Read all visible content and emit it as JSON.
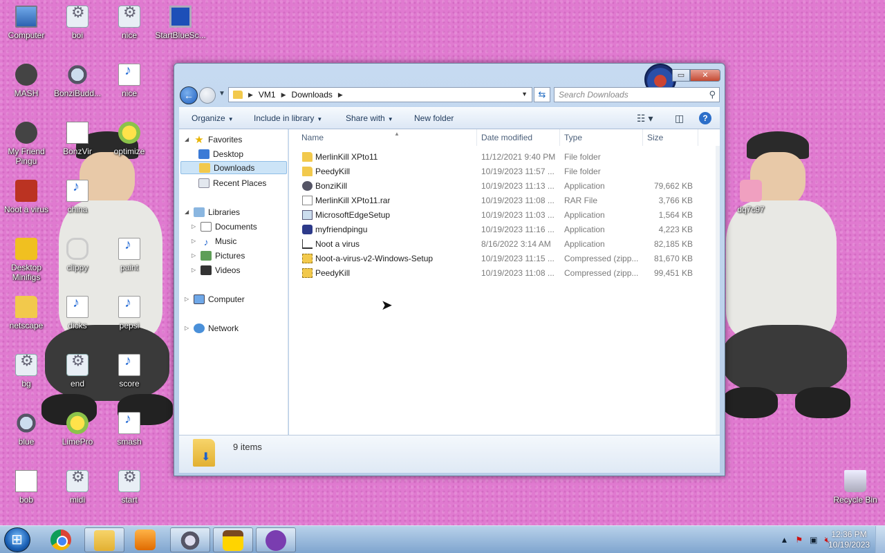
{
  "desktop": {
    "icons": [
      {
        "label": "Computer",
        "icon": "computer-icon"
      },
      {
        "label": "boi",
        "icon": "gear-icon"
      },
      {
        "label": "nice",
        "icon": "gear-icon"
      },
      {
        "label": "StartBlueSc...",
        "icon": "monitor-icon"
      },
      {
        "label": "MASH",
        "icon": "character-icon"
      },
      {
        "label": "BonziBudd...",
        "icon": "ufo-icon"
      },
      {
        "label": "nice",
        "icon": "audio-icon"
      },
      {
        "label": "My Friend Pingu",
        "icon": "pingu-icon"
      },
      {
        "label": "BonzVir",
        "icon": "document-icon"
      },
      {
        "label": "optimize",
        "icon": "optimize-icon"
      },
      {
        "label": "Noot a virus",
        "icon": "noot-icon"
      },
      {
        "label": "china",
        "icon": "audio-icon"
      },
      {
        "label": "Desktop Minifigs",
        "icon": "minifig-icon"
      },
      {
        "label": "clippy",
        "icon": "paperclip-icon"
      },
      {
        "label": "paint",
        "icon": "audio-icon"
      },
      {
        "label": "netscape",
        "icon": "folder-icon"
      },
      {
        "label": "dicks",
        "icon": "audio-icon"
      },
      {
        "label": "pepsi",
        "icon": "audio-icon"
      },
      {
        "label": "bg",
        "icon": "gear-icon"
      },
      {
        "label": "end",
        "icon": "gear-icon"
      },
      {
        "label": "score",
        "icon": "audio-icon"
      },
      {
        "label": "blue",
        "icon": "ufo-icon"
      },
      {
        "label": "LimePro",
        "icon": "lime-icon"
      },
      {
        "label": "smash",
        "icon": "audio-icon"
      },
      {
        "label": "bob",
        "icon": "document-icon"
      },
      {
        "label": "midi",
        "icon": "gear-icon"
      },
      {
        "label": "start",
        "icon": "gear-icon"
      },
      {
        "label": "dq7c97",
        "icon": "video-icon"
      },
      {
        "label": "Recycle Bin",
        "icon": "recycle-bin-icon"
      }
    ]
  },
  "explorer": {
    "breadcrumb": [
      "VM1",
      "Downloads"
    ],
    "search_placeholder": "Search Downloads",
    "toolbar": {
      "organize": "Organize",
      "include_in_library": "Include in library",
      "share_with": "Share with",
      "new_folder": "New folder"
    },
    "nav": {
      "favorites": "Favorites",
      "desktop": "Desktop",
      "downloads": "Downloads",
      "recent_places": "Recent Places",
      "libraries": "Libraries",
      "documents": "Documents",
      "music": "Music",
      "pictures": "Pictures",
      "videos": "Videos",
      "computer": "Computer",
      "network": "Network"
    },
    "columns": {
      "name": "Name",
      "date_modified": "Date modified",
      "type": "Type",
      "size": "Size"
    },
    "files": [
      {
        "name": "MerlinKill XPto11",
        "date": "11/12/2021 9:40 PM",
        "type": "File folder",
        "size": "",
        "icon": "folder-icon"
      },
      {
        "name": "PeedyKill",
        "date": "10/19/2023 11:57 ...",
        "type": "File folder",
        "size": "",
        "icon": "folder-icon"
      },
      {
        "name": "BonziKill",
        "date": "10/19/2023 11:13 ...",
        "type": "Application",
        "size": "79,662 KB",
        "icon": "application-icon"
      },
      {
        "name": "MerlinKill XPto11.rar",
        "date": "10/19/2023 11:08 ...",
        "type": "RAR File",
        "size": "3,766 KB",
        "icon": "rar-file-icon"
      },
      {
        "name": "MicrosoftEdgeSetup",
        "date": "10/19/2023 11:03 ...",
        "type": "Application",
        "size": "1,564 KB",
        "icon": "installer-icon"
      },
      {
        "name": "myfriendpingu",
        "date": "10/19/2023 11:16 ...",
        "type": "Application",
        "size": "4,223 KB",
        "icon": "pingu-app-icon"
      },
      {
        "name": "Noot a virus",
        "date": "8/16/2022 3:14 AM",
        "type": "Application",
        "size": "82,185 KB",
        "icon": "generic-app-icon"
      },
      {
        "name": "Noot-a-virus-v2-Windows-Setup",
        "date": "10/19/2023 11:15 ...",
        "type": "Compressed (zipp...",
        "size": "81,670 KB",
        "icon": "zip-folder-icon"
      },
      {
        "name": "PeedyKill",
        "date": "10/19/2023 11:08 ...",
        "type": "Compressed (zipp...",
        "size": "99,451 KB",
        "icon": "zip-folder-icon"
      }
    ],
    "status": "9 items"
  },
  "taskbar": {
    "time": "12:36 PM",
    "date": "10/19/2023"
  }
}
